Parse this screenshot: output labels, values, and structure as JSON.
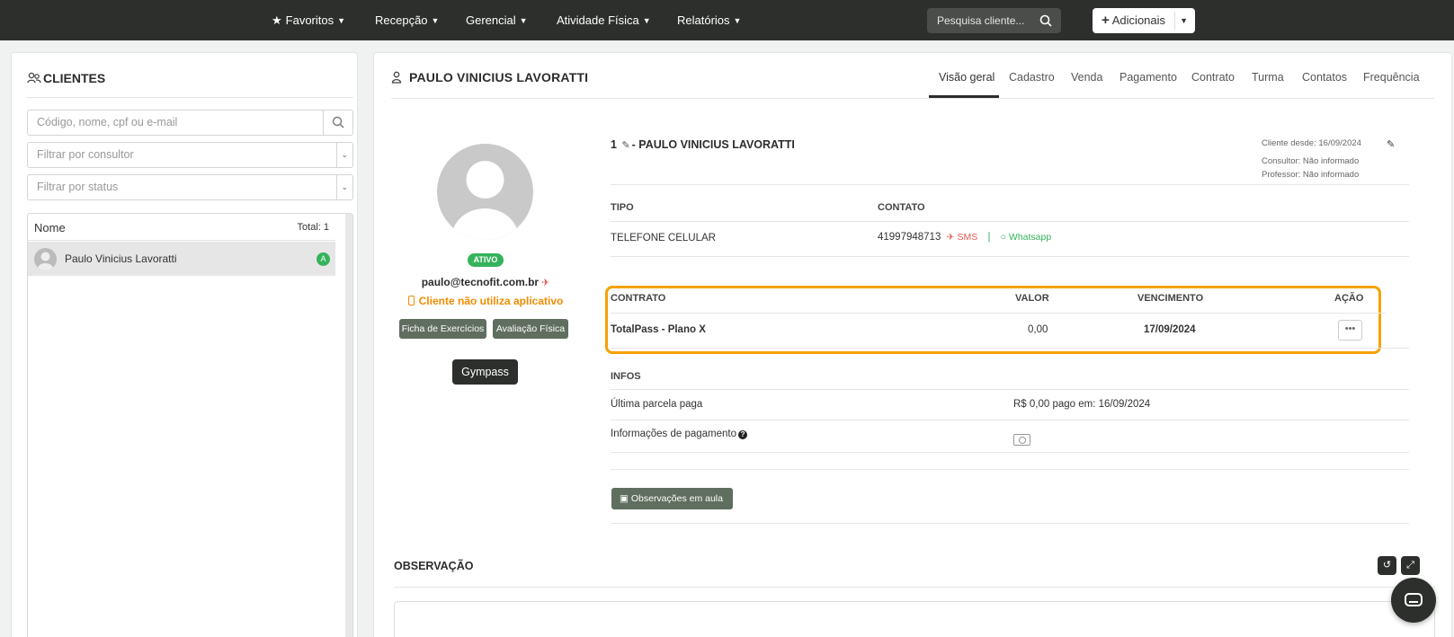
{
  "nav": {
    "items": [
      {
        "label": "Favoritos"
      },
      {
        "label": "Recepção"
      },
      {
        "label": "Gerencial"
      },
      {
        "label": "Atividade Física"
      },
      {
        "label": "Relatórios"
      }
    ],
    "search_label": "Pesquisa cliente...",
    "add_label": "Adicionais"
  },
  "sidebar": {
    "title": "CLIENTES",
    "search_placeholder": "Código, nome, cpf ou e-mail",
    "consultor_placeholder": "Filtrar por consultor",
    "status_placeholder": "Filtrar por status",
    "list_header": "Nome",
    "total": "Total: 1",
    "clients": [
      {
        "name": "Paulo Vinicius Lavoratti",
        "badge": "A"
      }
    ]
  },
  "main": {
    "title": "PAULO VINICIUS LAVORATTI",
    "tabs": [
      "Visão geral",
      "Cadastro",
      "Venda",
      "Pagamento",
      "Contrato",
      "Turma",
      "Contatos",
      "Frequência"
    ],
    "active_tab": "Visão geral",
    "profile": {
      "status": "ATIVO",
      "email": "paulo@tecnofit.com.br",
      "app_status": "Cliente não utiliza aplicativo",
      "btn_ficha": "Ficha de Exercícios",
      "btn_avaliacao": "Avaliação Física",
      "btn_gympass": "Gympass"
    },
    "client": {
      "id": "1",
      "name_suffix": "- PAULO VINICIUS LAVORATTI",
      "since": "Cliente desde: 16/09/2024",
      "consultor": "Consultor: Não informado",
      "professor": "Professor: Não informado"
    },
    "contact": {
      "h_tipo": "TIPO",
      "h_contato": "CONTATO",
      "tipo": "TELEFONE CELULAR",
      "phone": "41997948713",
      "sms": "SMS",
      "whatsapp": "Whatsapp"
    },
    "contract": {
      "h_contrato": "CONTRATO",
      "h_valor": "VALOR",
      "h_vencimento": "VENCIMENTO",
      "h_acao": "AÇÃO",
      "name": "TotalPass - Plano X",
      "valor": "0,00",
      "vencimento": "17/09/2024",
      "acao_icon": "ellipsis-icon"
    },
    "infos": {
      "title": "INFOS",
      "ultima_label": "Última parcela paga",
      "ultima_value": "R$ 0,00 pago em: 16/09/2024",
      "pagamento_label": "Informações de pagamento"
    },
    "obs_aula": "Observações em aula",
    "observacao_title": "OBSERVAÇÃO"
  },
  "colors": {
    "topbar": "#2c2f2c",
    "accent_green": "#35b35b",
    "highlight_orange": "#f5a100",
    "warning_orange": "#f08c00",
    "button_gray_green": "#5f6e5f"
  }
}
